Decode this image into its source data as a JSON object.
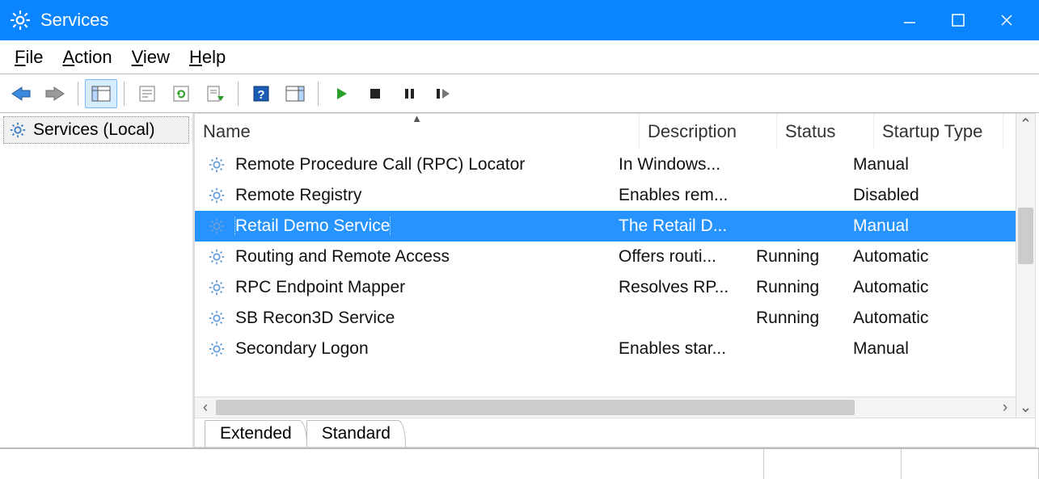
{
  "window": {
    "title": "Services"
  },
  "menu": {
    "file": "File",
    "action": "Action",
    "view": "View",
    "help": "Help"
  },
  "tree": {
    "root": "Services (Local)"
  },
  "columns": {
    "name": "Name",
    "description": "Description",
    "status": "Status",
    "startup": "Startup Type"
  },
  "services": [
    {
      "name": "Remote Procedure Call (RPC) Locator",
      "description": "In Windows...",
      "status": "",
      "startup": "Manual",
      "selected": false
    },
    {
      "name": "Remote Registry",
      "description": "Enables rem...",
      "status": "",
      "startup": "Disabled",
      "selected": false
    },
    {
      "name": "Retail Demo Service",
      "description": "The Retail D...",
      "status": "",
      "startup": "Manual",
      "selected": true
    },
    {
      "name": "Routing and Remote Access",
      "description": "Offers routi...",
      "status": "Running",
      "startup": "Automatic",
      "selected": false
    },
    {
      "name": "RPC Endpoint Mapper",
      "description": "Resolves RP...",
      "status": "Running",
      "startup": "Automatic",
      "selected": false
    },
    {
      "name": "SB Recon3D Service",
      "description": "",
      "status": "Running",
      "startup": "Automatic",
      "selected": false
    },
    {
      "name": "Secondary Logon",
      "description": "Enables star...",
      "status": "",
      "startup": "Manual",
      "selected": false
    }
  ],
  "tabs": {
    "extended": "Extended",
    "standard": "Standard"
  }
}
